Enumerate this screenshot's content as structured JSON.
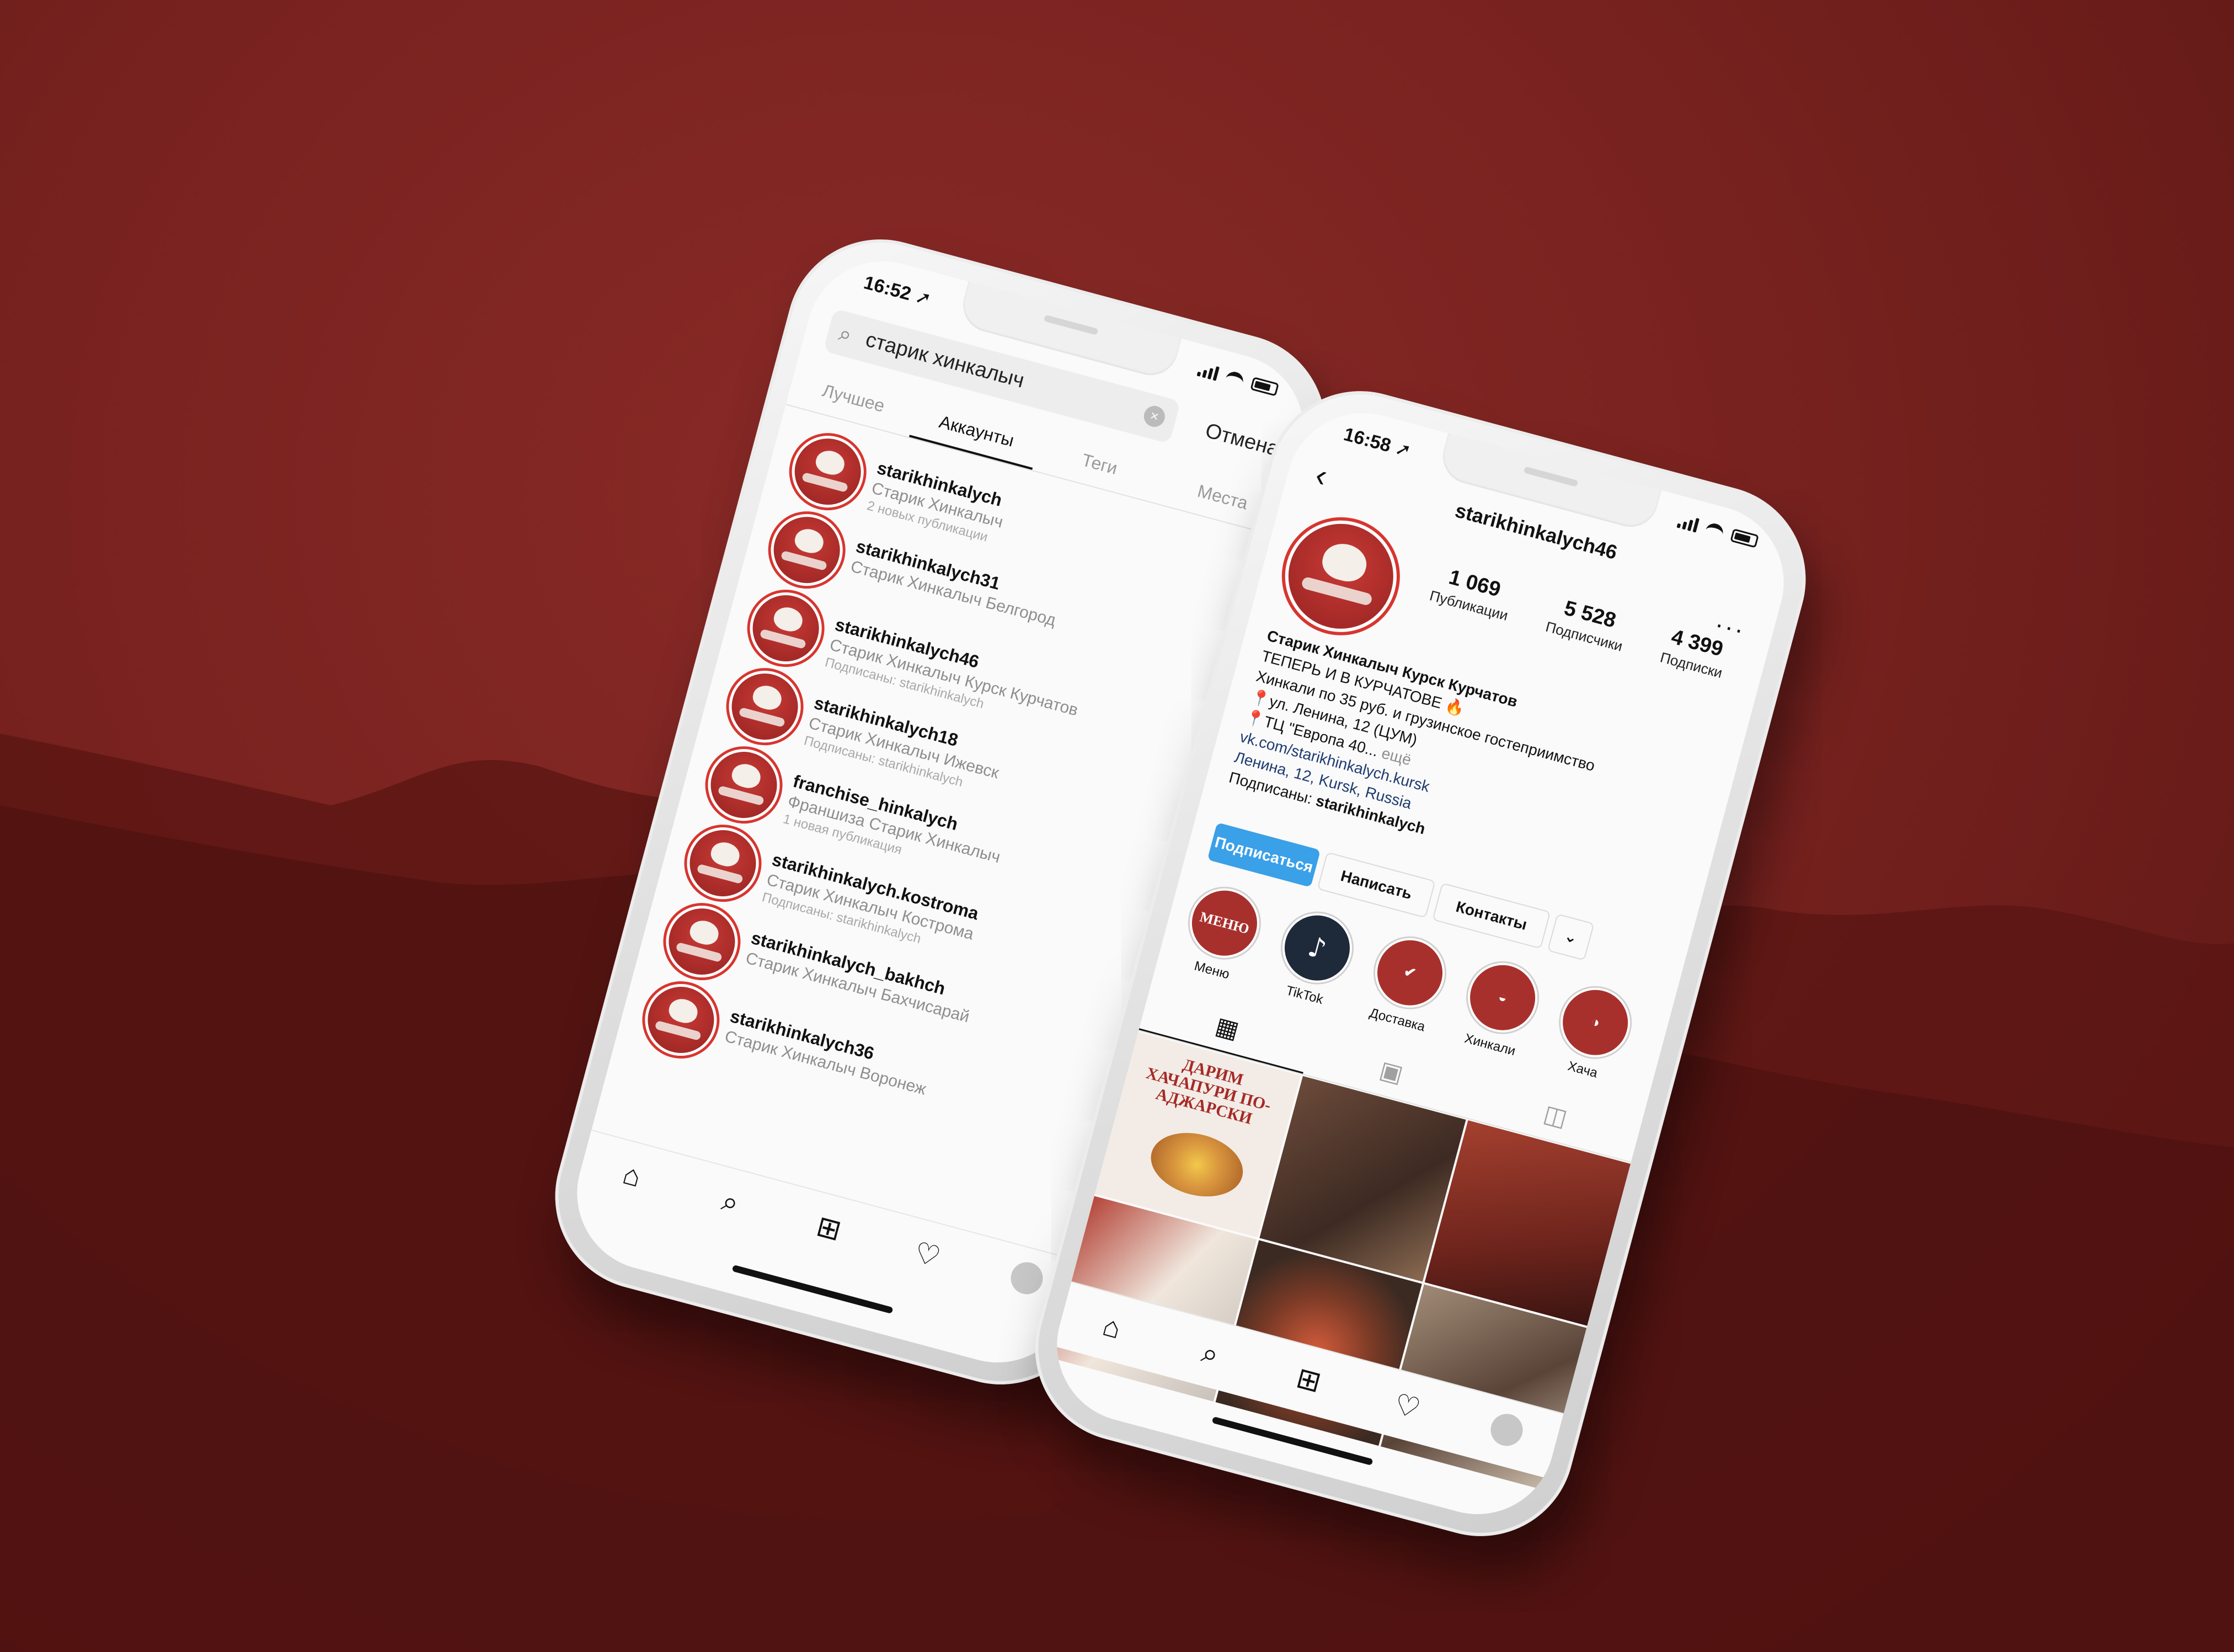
{
  "phone1": {
    "status": {
      "time": "16:52 ➚"
    },
    "search": {
      "query": "старик хинкалыч",
      "cancel_label": "Отмена"
    },
    "tabs": [
      "Лучшее",
      "Аккаунты",
      "Теги",
      "Места"
    ],
    "active_tab": "Аккаунты",
    "accounts": [
      {
        "name": "starikhinkalych",
        "subtitle": "Старик Хинкалыч",
        "meta": "2 новых публикации"
      },
      {
        "name": "starikhinkalych31",
        "subtitle": "Старик Хинкалыч Белгород",
        "meta": ""
      },
      {
        "name": "starikhinkalych46",
        "subtitle": "Старик Хинкалыч Курск Курчатов",
        "meta": "Подписаны: starikhinkalych"
      },
      {
        "name": "starikhinkalych18",
        "subtitle": "Старик Хинкалыч Ижевск",
        "meta": "Подписаны: starikhinkalych"
      },
      {
        "name": "franchise_hinkalych",
        "subtitle": "Франшиза Старик Хинкалыч",
        "meta": "1 новая публикация"
      },
      {
        "name": "starikhinkalych.kostroma",
        "subtitle": "Старик Хинкалыч Кострома",
        "meta": "Подписаны: starikhinkalych"
      },
      {
        "name": "starikhinkalych_bakhch",
        "subtitle": "Старик Хинкалыч Бахчисарай",
        "meta": ""
      },
      {
        "name": "starikhinkalych36",
        "subtitle": "Старик Хинкалыч Воронеж",
        "meta": ""
      }
    ]
  },
  "phone2": {
    "status": {
      "time": "16:58 ➚"
    },
    "username": "starikhinkalych46",
    "stats": [
      {
        "value": "1 069",
        "label": "Публикации"
      },
      {
        "value": "5 528",
        "label": "Подписчики"
      },
      {
        "value": "4 399",
        "label": "Подписки"
      }
    ],
    "bio": {
      "name": "Старик Хинкалыч Курск Курчатов",
      "line1": "ТЕПЕРЬ И В КУРЧАТОВЕ 🔥",
      "line2": "Хинкали по 35 руб. и грузинское гостеприимство",
      "line3": "📍ул. Ленина, 12 (ЦУМ)",
      "line4": "📍ТЦ \"Европа 40...",
      "more": "ещё",
      "link": "vk.com/starikhinkalych.kursk",
      "address": "Ленина, 12, Kursk, Russia",
      "followed_prefix": "Подписаны: ",
      "followed_by": "starikhinkalych"
    },
    "buttons": {
      "follow": "Подписаться",
      "message": "Написать",
      "contacts": "Контакты",
      "expand": "⌄"
    },
    "highlights": [
      {
        "label": "Меню",
        "cover": "МЕНЮ"
      },
      {
        "label": "TikTok",
        "cover": "♪"
      },
      {
        "label": "Доставка",
        "cover": ""
      },
      {
        "label": "Хинкали",
        "cover": ""
      },
      {
        "label": "Хача",
        "cover": ""
      }
    ],
    "promo": {
      "title": "ДАРИМ ХАЧАПУРИ ПО-АДЖАРСКИ"
    }
  }
}
